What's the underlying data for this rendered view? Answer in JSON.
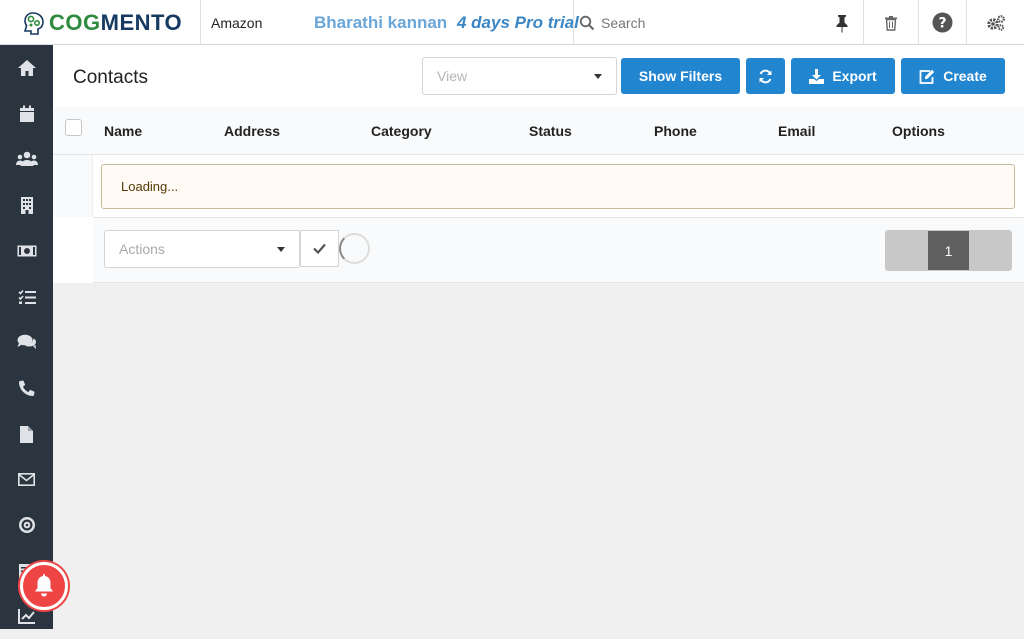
{
  "header": {
    "logo_prefix": "COG",
    "logo_suffix": "MENTO",
    "company": "Amazon",
    "user_name": "Bharathi kannan",
    "trial": "4 days Pro trial",
    "search_placeholder": "Search"
  },
  "sidebar": {
    "items": [
      {
        "name": "home",
        "icon": "home-icon"
      },
      {
        "name": "calendar",
        "icon": "calendar-icon"
      },
      {
        "name": "contacts",
        "icon": "users-icon"
      },
      {
        "name": "companies",
        "icon": "building-icon"
      },
      {
        "name": "deals",
        "icon": "money-icon"
      },
      {
        "name": "tasks",
        "icon": "tasks-icon"
      },
      {
        "name": "cases",
        "icon": "comments-icon"
      },
      {
        "name": "calls",
        "icon": "phone-icon"
      },
      {
        "name": "documents",
        "icon": "file-icon"
      },
      {
        "name": "email",
        "icon": "envelope-icon"
      },
      {
        "name": "campaigns",
        "icon": "target-icon"
      },
      {
        "name": "forms",
        "icon": "list-icon"
      },
      {
        "name": "reports",
        "icon": "chart-icon"
      }
    ]
  },
  "page": {
    "title": "Contacts",
    "view_placeholder": "View",
    "buttons": {
      "show_filters": "Show Filters",
      "export": "Export",
      "create": "Create"
    }
  },
  "table": {
    "columns": [
      "Name",
      "Address",
      "Category",
      "Status",
      "Phone",
      "Email",
      "Options"
    ],
    "loading_text": "Loading...",
    "actions_placeholder": "Actions",
    "pagination": {
      "current_page": "1"
    }
  },
  "colors": {
    "primary_button": "#2185d0",
    "sidebar": "#2b3540",
    "logo_green": "#2f8b3f",
    "logo_navy": "#173a63",
    "notification": "#e44"
  }
}
